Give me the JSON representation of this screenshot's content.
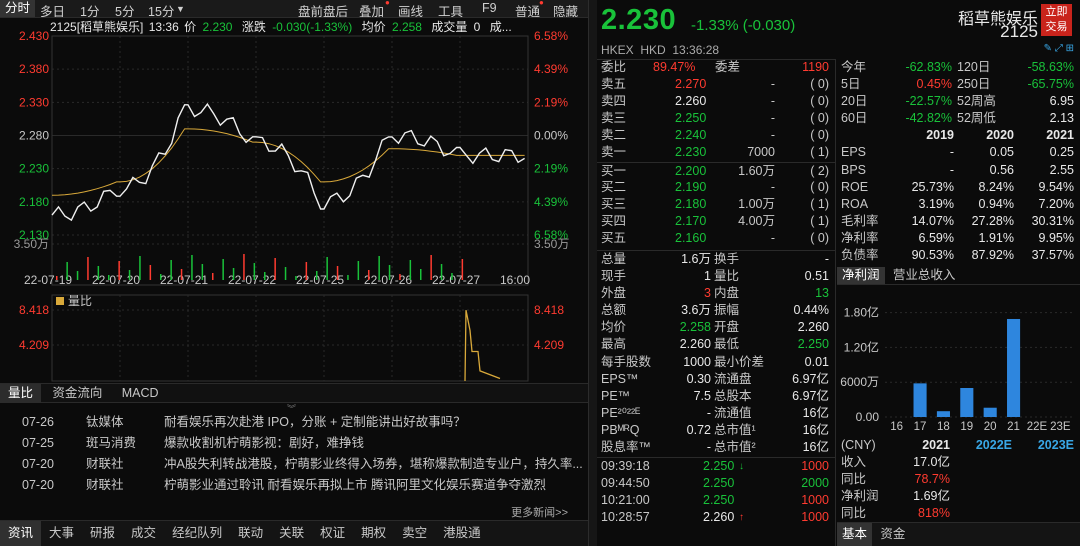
{
  "toolbar": {
    "items": [
      "分时",
      "多日",
      "1分",
      "5分",
      "15分",
      "盘前盘后",
      "叠加",
      "画线",
      "工具",
      "F9",
      "普通",
      "隐藏"
    ]
  },
  "infobar": {
    "stock": "2125[稻草熊娱乐]",
    "time": "13:36",
    "price_label": "价",
    "price": "2.230",
    "chg_label": "涨跌",
    "chg": "-0.030(-1.33%)",
    "avg_label": "均价",
    "avg": "2.258",
    "vol_label": "成交量",
    "vol": "0",
    "trail": "成..."
  },
  "chart_axes": {
    "price_left": [
      "2.430",
      "2.380",
      "2.330",
      "2.280",
      "2.230",
      "2.180",
      "2.130"
    ],
    "pct_right": [
      "6.58%",
      "4.39%",
      "2.19%",
      "0.00%",
      "2.19%",
      "4.39%",
      "6.58%"
    ],
    "vol_label": "3.50万",
    "dates": [
      "22-07-19",
      "22-07-20",
      "22-07-21",
      "22-07-22",
      "22-07-25",
      "22-07-26",
      "22-07-27",
      "16:00"
    ],
    "sub_title": "量比",
    "sub_ticks": [
      "8.418",
      "4.209"
    ]
  },
  "chart_data": [
    {
      "type": "line",
      "title": "",
      "x": [
        "22-07-19",
        "22-07-20",
        "22-07-21",
        "22-07-22",
        "22-07-25",
        "22-07-26",
        "22-07-27"
      ],
      "series": [
        {
          "values": [
            2.16,
            2.2,
            2.32,
            2.27,
            2.18,
            2.28,
            2.25
          ]
        },
        {
          "values": [
            2.19,
            2.21,
            2.29,
            2.27,
            2.21,
            2.26,
            2.25
          ]
        }
      ],
      "ylim": [
        2.13,
        2.43
      ]
    },
    {
      "type": "line",
      "title": "量比",
      "series": [
        {
          "name": "量比",
          "values": [
            0,
            0,
            0,
            0,
            0,
            0,
            8.4,
            3.5,
            1.2
          ]
        }
      ],
      "ylim": [
        0,
        8.418
      ]
    },
    {
      "type": "bar",
      "title": "净利润",
      "categories": [
        "16",
        "17",
        "18",
        "19",
        "20",
        "21",
        "22E",
        "23E"
      ],
      "values": [
        0,
        0.58,
        0.1,
        0.5,
        0.16,
        1.69,
        null,
        null
      ],
      "ylabel": "亿",
      "ylim": [
        0,
        2.0
      ]
    }
  ],
  "sub_tabs": [
    "量比",
    "资金流向",
    "MACD"
  ],
  "news": [
    {
      "date": "07-26",
      "source": "钛媒体",
      "title": "耐看娱乐再次赴港 IPO，分账 + 定制能讲出好故事吗？"
    },
    {
      "date": "07-25",
      "source": "斑马消费",
      "title": "爆款收割机柠萌影视：剧好，难挣钱"
    },
    {
      "date": "07-20",
      "source": "财联社",
      "title": "冲A股失利转战港股，柠萌影业终得入场券，堪称爆款制造专业户，持久率..."
    },
    {
      "date": "07-20",
      "source": "财联社",
      "title": "柠萌影业通过聆讯 耐看娱乐再拟上市 腾讯阿里文化娱乐赛道争夺激烈"
    }
  ],
  "more_news": "更多新闻>>",
  "bottom_tabs": [
    "资讯",
    "大事",
    "研报",
    "成交",
    "经纪队列",
    "联动",
    "关联",
    "权证",
    "期权",
    "卖空",
    "港股通"
  ],
  "quote": {
    "price": "2.230",
    "change": "-1.33% (-0.030)",
    "name": "稻草熊娱乐",
    "code": "2125",
    "trade_btn": [
      "立即",
      "交易"
    ],
    "market": "HKEX",
    "currency": "HKD",
    "time": "13:36:28"
  },
  "order_book": {
    "ratio_label": "委比",
    "ratio": "89.47%",
    "diff_label": "委差",
    "diff": "1190",
    "asks": [
      {
        "label": "卖五",
        "price": "2.270",
        "vol": "-",
        "orders": "0"
      },
      {
        "label": "卖四",
        "price": "2.260",
        "vol": "-",
        "orders": "0"
      },
      {
        "label": "卖三",
        "price": "2.250",
        "vol": "-",
        "orders": "0"
      },
      {
        "label": "卖二",
        "price": "2.240",
        "vol": "-",
        "orders": "0"
      },
      {
        "label": "卖一",
        "price": "2.230",
        "vol": "7000",
        "orders": "1"
      }
    ],
    "bids": [
      {
        "label": "买一",
        "price": "2.200",
        "vol": "1.60万",
        "orders": "2"
      },
      {
        "label": "买二",
        "price": "2.190",
        "vol": "-",
        "orders": "0"
      },
      {
        "label": "买三",
        "price": "2.180",
        "vol": "1.00万",
        "orders": "1"
      },
      {
        "label": "买四",
        "price": "2.170",
        "vol": "4.00万",
        "orders": "1"
      },
      {
        "label": "买五",
        "price": "2.160",
        "vol": "-",
        "orders": "0"
      }
    ]
  },
  "stats": [
    {
      "l1": "总量",
      "v1": "1.6万",
      "l2": "换手",
      "v2": "-"
    },
    {
      "l1": "现手",
      "v1": "1",
      "l2": "量比",
      "v2": "0.51"
    },
    {
      "l1": "外盘",
      "v1": "3",
      "l2": "内盘",
      "v2": "13"
    },
    {
      "l1": "总额",
      "v1": "3.6万",
      "l2": "振幅",
      "v2": "0.44%"
    },
    {
      "l1": "均价",
      "v1": "2.258",
      "l2": "开盘",
      "v2": "2.260"
    },
    {
      "l1": "最高",
      "v1": "2.260",
      "l2": "最低",
      "v2": "2.250"
    },
    {
      "l1": "每手股数",
      "v1": "1000",
      "l2": "最小价差",
      "v2": "0.01"
    },
    {
      "l1": "EPS™",
      "v1": "0.30",
      "l2": "流通盘",
      "v2": "6.97亿"
    },
    {
      "l1": "PE™",
      "v1": "7.5",
      "l2": "总股本",
      "v2": "6.97亿"
    },
    {
      "l1": "PE²⁰²²ᴱ",
      "v1": "-",
      "l2": "流通值",
      "v2": "16亿"
    },
    {
      "l1": "PBᴹᴿQ",
      "v1": "0.72",
      "l2": "总市值¹",
      "v2": "16亿"
    },
    {
      "l1": "股息率™",
      "v1": "-",
      "l2": "总市值²",
      "v2": "16亿"
    }
  ],
  "ticks": [
    {
      "time": "09:39:18",
      "price": "2.250",
      "arrow": "down",
      "vol": "1000"
    },
    {
      "time": "09:44:50",
      "price": "2.250",
      "arrow": "",
      "vol": "2000"
    },
    {
      "time": "10:21:00",
      "price": "2.250",
      "arrow": "",
      "vol": "1000"
    },
    {
      "time": "10:28:57",
      "price": "2.260",
      "arrow": "up",
      "vol": "1000"
    }
  ],
  "perf": [
    {
      "l1": "今年",
      "v1": "-62.83%",
      "l2": "120日",
      "v2": "-58.63%"
    },
    {
      "l1": "5日",
      "v1": "0.45%",
      "l2": "250日",
      "v2": "-65.75%"
    },
    {
      "l1": "20日",
      "v1": "-22.57%",
      "l2": "52周高",
      "v2": "6.95"
    },
    {
      "l1": "60日",
      "v1": "-42.82%",
      "l2": "52周低",
      "v2": "2.13"
    }
  ],
  "fin_years": [
    "2019",
    "2020",
    "2021"
  ],
  "fin_rows": [
    {
      "label": "EPS",
      "v": [
        "-",
        "0.05",
        "0.25"
      ]
    },
    {
      "label": "BPS",
      "v": [
        "-",
        "0.56",
        "2.55"
      ]
    },
    {
      "label": "ROE",
      "v": [
        "25.73%",
        "8.24%",
        "9.54%"
      ]
    },
    {
      "label": "ROA",
      "v": [
        "3.19%",
        "0.94%",
        "7.20%"
      ]
    },
    {
      "label": "毛利率",
      "v": [
        "14.07%",
        "27.28%",
        "30.31%"
      ]
    },
    {
      "label": "净利率",
      "v": [
        "6.59%",
        "1.91%",
        "9.95%"
      ]
    },
    {
      "label": "负债率",
      "v": [
        "90.53%",
        "87.92%",
        "37.57%"
      ]
    }
  ],
  "chart_tabs": [
    "净利润",
    "营业总收入"
  ],
  "fin_chart_axis": [
    "1.80亿",
    "1.20亿",
    "6000万",
    "0.00"
  ],
  "fin_chart_x": [
    "16",
    "17",
    "18",
    "19",
    "20",
    "21",
    "22E",
    "23E"
  ],
  "currency_note": "(CNY)",
  "forecast_years": [
    "2021",
    "2022E",
    "2023E"
  ],
  "forecast_rows": [
    {
      "label": "收入",
      "v": "17.0亿"
    },
    {
      "label": "同比",
      "v": "78.7%"
    },
    {
      "label": "净利润",
      "v": "1.69亿"
    },
    {
      "label": "同比",
      "v": "818%"
    }
  ],
  "right_tabs": [
    "基本",
    "资金"
  ]
}
